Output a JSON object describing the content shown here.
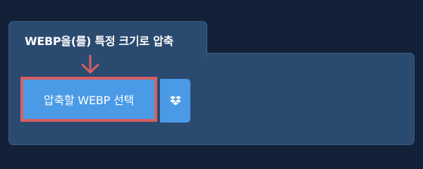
{
  "tab": {
    "title": "WEBP을(를) 특정 크기로 압축"
  },
  "buttons": {
    "select_label": "압축할 WEBP 선택",
    "dropbox_icon": "dropbox-icon"
  },
  "colors": {
    "page_bg": "#122137",
    "panel_bg": "#2b4a70",
    "button_bg": "#4b9ae6",
    "highlight": "#d75f61"
  }
}
